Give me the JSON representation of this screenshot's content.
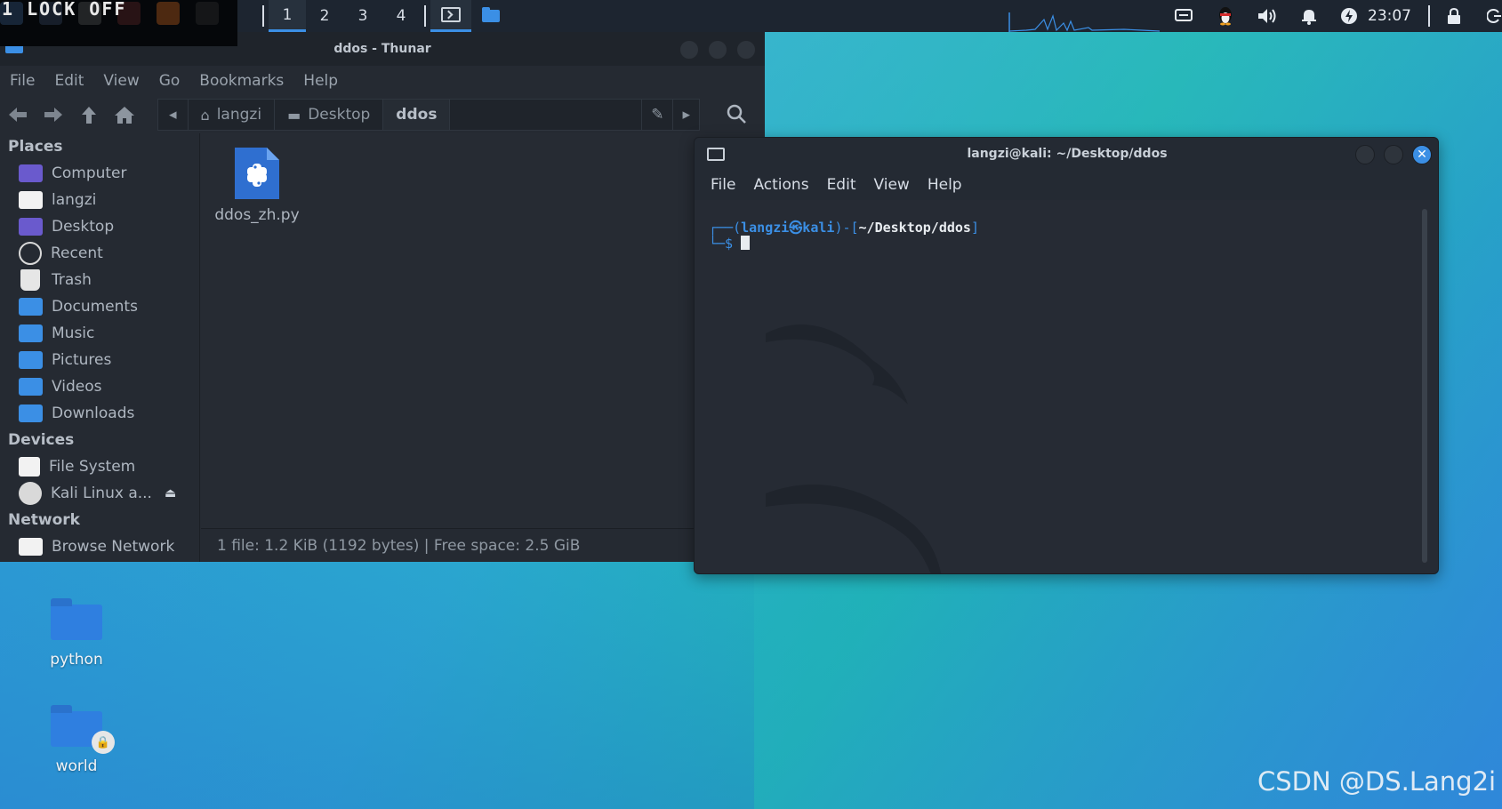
{
  "panel": {
    "lock_text": "1 LOCK OFF",
    "workspaces": [
      "1",
      "2",
      "3",
      "4"
    ],
    "active_workspace": "1",
    "clock": "23:07",
    "accent": "#3b8fe5"
  },
  "thunar": {
    "title": "ddos - Thunar",
    "menu": [
      "File",
      "Edit",
      "View",
      "Go",
      "Bookmarks",
      "Help"
    ],
    "breadcrumbs": [
      "langzi",
      "Desktop",
      "ddos"
    ],
    "sidebar": {
      "places_header": "Places",
      "places": [
        "Computer",
        "langzi",
        "Desktop",
        "Recent",
        "Trash",
        "Documents",
        "Music",
        "Pictures",
        "Videos",
        "Downloads"
      ],
      "devices_header": "Devices",
      "devices": [
        "File System",
        "Kali Linux a..."
      ],
      "network_header": "Network",
      "network": [
        "Browse Network"
      ]
    },
    "files": [
      {
        "name": "ddos_zh.py",
        "icon": "python-file-icon"
      }
    ],
    "status": "1 file: 1.2 KiB (1192 bytes)  |  Free space: 2.5 GiB"
  },
  "terminal": {
    "title": "langzi@kali: ~/Desktop/ddos",
    "menu": [
      "File",
      "Actions",
      "Edit",
      "View",
      "Help"
    ],
    "prompt": {
      "open": "┌──(",
      "user": "langzi㉿kali",
      "mid": ")-[",
      "path": "~/Desktop/ddos",
      "close": "]",
      "line2": "└─$ "
    }
  },
  "desktop": {
    "icons": [
      {
        "label": "python",
        "locked": false
      },
      {
        "label": "world",
        "locked": true
      }
    ],
    "watermark": "CSDN @DS.Lang2i"
  }
}
